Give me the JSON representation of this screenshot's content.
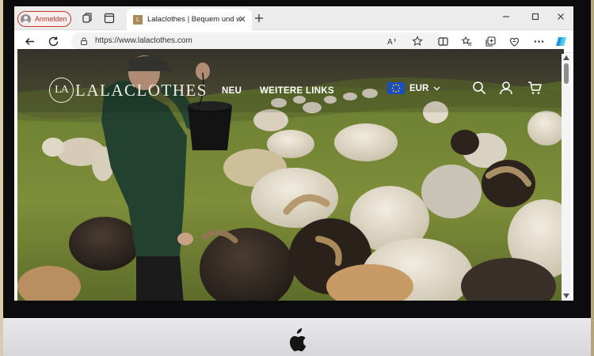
{
  "browser": {
    "profile_label": "Anmelden",
    "tab": {
      "title": "Lalaclothes | Bequem und weich",
      "favicon_letter": "L"
    },
    "url": "https://www.lalaclothes.com",
    "accent_color": "#c0392b"
  },
  "site": {
    "logo_mark": "LA",
    "logo_text": "LALACLOTHES",
    "nav": [
      "NEU",
      "WEITERE LINKS"
    ],
    "currency": "EUR",
    "icons": [
      "search-icon",
      "account-icon",
      "cart-icon"
    ]
  },
  "hero": {
    "scene": "shepherd feeding flock of sheep on green hillside"
  }
}
